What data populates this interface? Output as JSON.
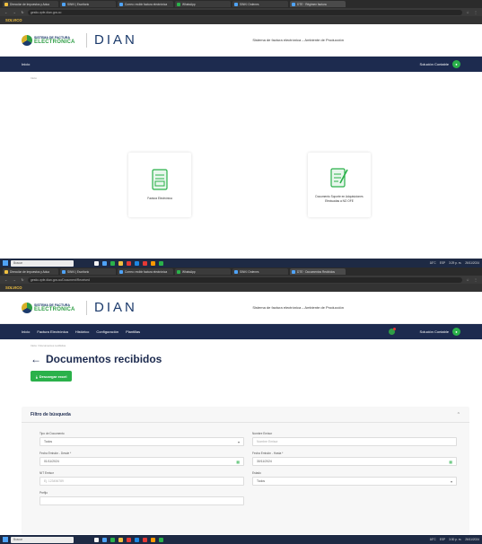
{
  "browser": {
    "tabs_top": [
      {
        "label": "Dirección de Impuestos y Adua",
        "color": "#f0c040"
      },
      {
        "label": "SINKI | Escritorio",
        "color": "#4fa3f7"
      },
      {
        "label": "Correo: recibir factura electrónica",
        "color": "#4fa3f7"
      },
      {
        "label": "WhatsApp",
        "color": "#2ab14a"
      },
      {
        "label": "SINKI Ordenes",
        "color": "#4fa3f7"
      },
      {
        "label": "DTE · Régimen factura",
        "color": "#4fa3f7"
      }
    ],
    "tabs_bottom": [
      {
        "label": "Dirección de Impuestos y Adua",
        "color": "#f0c040"
      },
      {
        "label": "SINKI | Escritorio",
        "color": "#4fa3f7"
      },
      {
        "label": "Correo: recibir factura electrónica",
        "color": "#4fa3f7"
      },
      {
        "label": "WhatsApp",
        "color": "#2ab14a"
      },
      {
        "label": "SINKI Ordenes",
        "color": "#4fa3f7"
      },
      {
        "label": "DTE · Documentos Recibidos",
        "color": "#4fa3f7"
      }
    ],
    "url_top": "gestio.vpfe.dian.gov.co",
    "url_bottom": "gestio.vpfe.dian.gov.co/Document/Received",
    "bookmark": "SOLVICO"
  },
  "header": {
    "logo_line1": "SISTEMA DE FACTURA",
    "logo_line2": "ELECTRÓNICA",
    "logo_dian": "DIAN",
    "system_title": "Sistema de factura electrónica – Ambiente de Producción"
  },
  "nav_top": {
    "items": [
      "Inicio"
    ],
    "user": "Solución Contable"
  },
  "nav_bottom": {
    "items": [
      "Inicio",
      "Factura Electrónica",
      "Histórico",
      "Configuración",
      "Plantillas"
    ],
    "user": "Solución Contable"
  },
  "screen1": {
    "breadcrumb": "Inicio",
    "cards": [
      {
        "label": "Factura Electrónica",
        "icon": "invoice-icon"
      },
      {
        "label": "Documento Soporte en Adquisiciones Efectuadas a NO OFE",
        "icon": "support-document-icon"
      }
    ]
  },
  "screen2": {
    "breadcrumb": "Inicio / Documentos recibidos",
    "title": "Documentos recibidos",
    "download_button": "Descargar excel",
    "filter": {
      "title": "Filtro de búsqueda",
      "fields": {
        "doc_type": {
          "label": "Tipo de Documento",
          "value": "Todos"
        },
        "issuer_name": {
          "label": "Nombre Emisor",
          "placeholder": "Nombre Emisor"
        },
        "date_from": {
          "label": "Fecha Emisión - Desde *",
          "value": "01/11/2024"
        },
        "date_to": {
          "label": "Fecha Emisión - Hasta *",
          "value": "30/11/2024"
        },
        "nit": {
          "label": "NIT Emisor",
          "placeholder": "Ej. 123456789"
        },
        "state": {
          "label": "Estado",
          "value": "Todos"
        },
        "prefix": {
          "label": "Prefijo",
          "placeholder": ""
        }
      }
    }
  },
  "taskbar": {
    "search": "Buscar",
    "weather_top": "18°C",
    "time_top": "3:29 p. m.",
    "date_top": "26/11/2024",
    "weather_bottom": "18°C",
    "time_bottom": "3:30 p. m.",
    "date_bottom": "26/11/2024",
    "lang": "ESP"
  }
}
